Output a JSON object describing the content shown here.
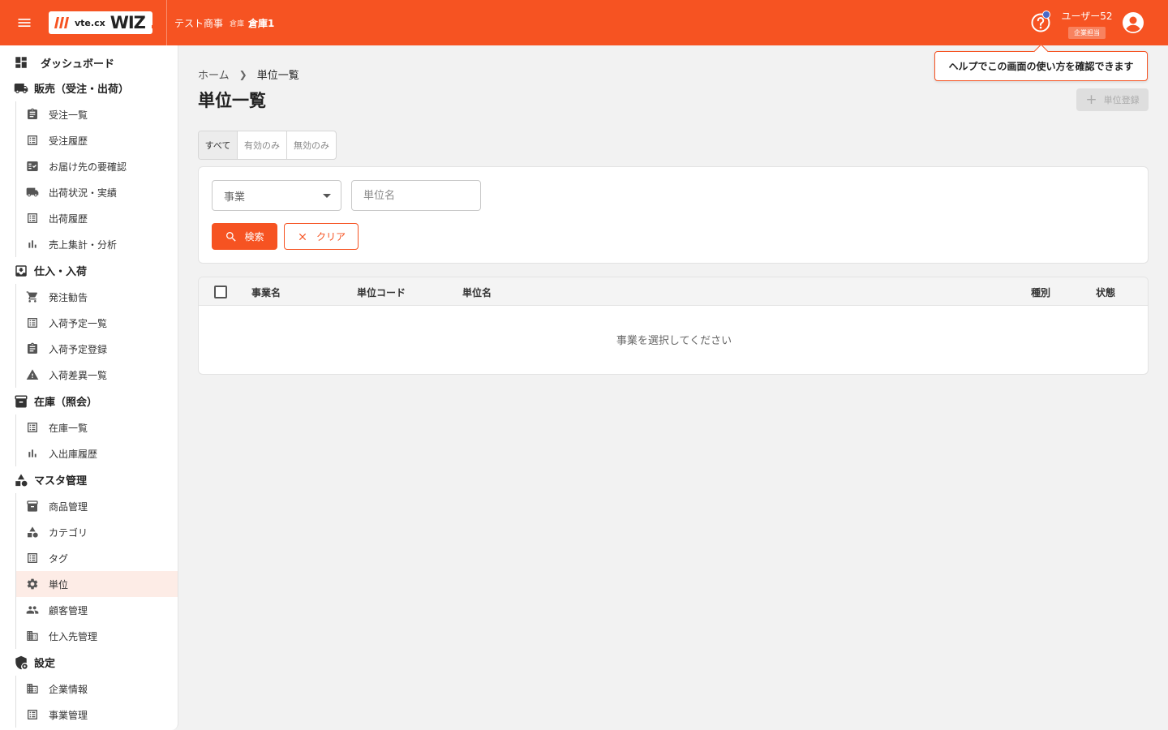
{
  "header": {
    "logo_vte": "vte.cx",
    "logo_wiz": "WIZ",
    "company": "テスト商事",
    "warehouse_label": "倉庫",
    "warehouse_name": "倉庫1",
    "user_name": "ユーザー52",
    "user_role": "企業担当",
    "brand_color": "#f65322"
  },
  "tooltip": {
    "text": "ヘルプでこの画面の使い方を確認できます"
  },
  "sidebar": {
    "dashboard": "ダッシュボード",
    "sections": [
      {
        "label": "販売（受注・出荷）",
        "icon": "truck-icon",
        "items": [
          "受注一覧",
          "受注履歴",
          "お届け先の要確認",
          "出荷状況・実績",
          "出荷履歴",
          "売上集計・分析"
        ]
      },
      {
        "label": "仕入・入荷",
        "icon": "inbox-icon",
        "items": [
          "発注勧告",
          "入荷予定一覧",
          "入荷予定登録",
          "入荷差異一覧"
        ]
      },
      {
        "label": "在庫（照会）",
        "icon": "archive-icon",
        "items": [
          "在庫一覧",
          "入出庫履歴"
        ]
      },
      {
        "label": "マスタ管理",
        "icon": "shapes-icon",
        "items": [
          "商品管理",
          "カテゴリ",
          "タグ",
          "単位",
          "顧客管理",
          "仕入先管理"
        ]
      },
      {
        "label": "設定",
        "icon": "settings-shield-icon",
        "items": [
          "企業情報",
          "事業管理"
        ]
      }
    ]
  },
  "breadcrumb": {
    "home": "ホーム",
    "current": "単位一覧"
  },
  "page": {
    "title": "単位一覧",
    "add_button": "単位登録"
  },
  "filter_tabs": [
    {
      "label": "すべて",
      "active": true
    },
    {
      "label": "有効のみ",
      "active": false
    },
    {
      "label": "無効のみ",
      "active": false
    }
  ],
  "search": {
    "business_select": "事業",
    "unit_name_placeholder": "単位名",
    "search_button": "検索",
    "clear_button": "クリア"
  },
  "table": {
    "columns": [
      "事業名",
      "単位コード",
      "単位名",
      "種別",
      "状態"
    ],
    "empty_message": "事業を選択してください"
  }
}
